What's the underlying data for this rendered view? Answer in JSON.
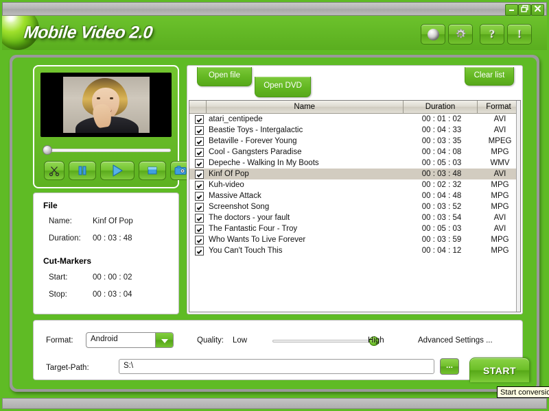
{
  "window": {
    "title": "Mobile Video 2.0",
    "controls": [
      {
        "name": "minimize",
        "glyph": "_"
      },
      {
        "name": "restore",
        "glyph": "❐"
      },
      {
        "name": "close",
        "glyph": "✕"
      }
    ]
  },
  "header": {
    "title": "Mobile Video 2.0",
    "buttons": [
      {
        "name": "globe-icon",
        "label": ""
      },
      {
        "name": "gear-icon",
        "label": "✲"
      },
      {
        "name": "help-icon",
        "label": "?"
      },
      {
        "name": "info-icon",
        "label": "!"
      }
    ]
  },
  "preview": {
    "seek_position_percent": 0,
    "controls": [
      {
        "name": "cut-button",
        "icon": "scissors-icon"
      },
      {
        "name": "pause-button",
        "icon": "pause-icon"
      },
      {
        "name": "play-button",
        "icon": "play-icon"
      },
      {
        "name": "stop-button",
        "icon": "stop-icon"
      },
      {
        "name": "snapshot-button",
        "icon": "camera-icon"
      }
    ]
  },
  "file_info": {
    "heading_file": "File",
    "name_label": "Name:",
    "name_value": "Kinf Of Pop",
    "duration_label": "Duration:",
    "duration_value": "00 : 03 : 48",
    "heading_cut": "Cut-Markers",
    "start_label": "Start:",
    "start_value": "00 : 00 : 02",
    "stop_label": "Stop:",
    "stop_value": "00 : 03 : 04"
  },
  "tabs": {
    "open_file": "Open file",
    "open_dvd": "Open DVD",
    "clear_list": "Clear list"
  },
  "list": {
    "columns": [
      "",
      "Name",
      "Duration",
      "Format"
    ],
    "rows": [
      {
        "checked": true,
        "name": "atari_centipede",
        "duration": "00 : 01 : 02",
        "format": "AVI",
        "selected": false
      },
      {
        "checked": true,
        "name": "Beastie Toys - Intergalactic",
        "duration": "00 : 04 : 33",
        "format": "AVI",
        "selected": false
      },
      {
        "checked": true,
        "name": "Betaville - Forever Young",
        "duration": "00 : 03 : 35",
        "format": "MPEG",
        "selected": false
      },
      {
        "checked": true,
        "name": "Cool - Gangsters Paradise",
        "duration": "00 : 04 : 08",
        "format": "MPG",
        "selected": false
      },
      {
        "checked": true,
        "name": "Depeche - Walking In My Boots",
        "duration": "00 : 05 : 03",
        "format": "WMV",
        "selected": false
      },
      {
        "checked": true,
        "name": "Kinf Of Pop",
        "duration": "00 : 03 : 48",
        "format": "AVI",
        "selected": true
      },
      {
        "checked": true,
        "name": "Kuh-video",
        "duration": "00 : 02 : 32",
        "format": "MPG",
        "selected": false
      },
      {
        "checked": true,
        "name": "Massive Attack",
        "duration": "00 : 04 : 48",
        "format": "MPG",
        "selected": false
      },
      {
        "checked": true,
        "name": "Screenshot Song",
        "duration": "00 : 03 : 52",
        "format": "MPG",
        "selected": false
      },
      {
        "checked": true,
        "name": "The doctors - your fault",
        "duration": "00 : 03 : 54",
        "format": "AVI",
        "selected": false
      },
      {
        "checked": true,
        "name": "The Fantastic Four - Troy",
        "duration": "00 : 05 : 03",
        "format": "AVI",
        "selected": false
      },
      {
        "checked": true,
        "name": "Who Wants To Live Forever",
        "duration": "00 : 03 : 59",
        "format": "MPG",
        "selected": false
      },
      {
        "checked": true,
        "name": "You Can't Touch This",
        "duration": "00 : 04 : 12",
        "format": "MPG",
        "selected": false
      }
    ]
  },
  "settings": {
    "format_label": "Format:",
    "format_value": "Android",
    "quality_label": "Quality:",
    "quality_low": "Low",
    "quality_high": "High",
    "quality_percent": 93,
    "advanced_settings": "Advanced Settings ...",
    "target_label": "Target-Path:",
    "target_value": "S:\\",
    "target_placeholder": "S:\\",
    "browse_label": "...",
    "start_label": "START"
  },
  "tooltip": {
    "text": "Start conversio"
  },
  "colors": {
    "brand_green": "#5fbb25",
    "green_dark": "#4d9a16",
    "accent_blue": "#2e8ed6",
    "selection": "#d2ccc0",
    "tooltip_bg": "#ffffe1"
  }
}
